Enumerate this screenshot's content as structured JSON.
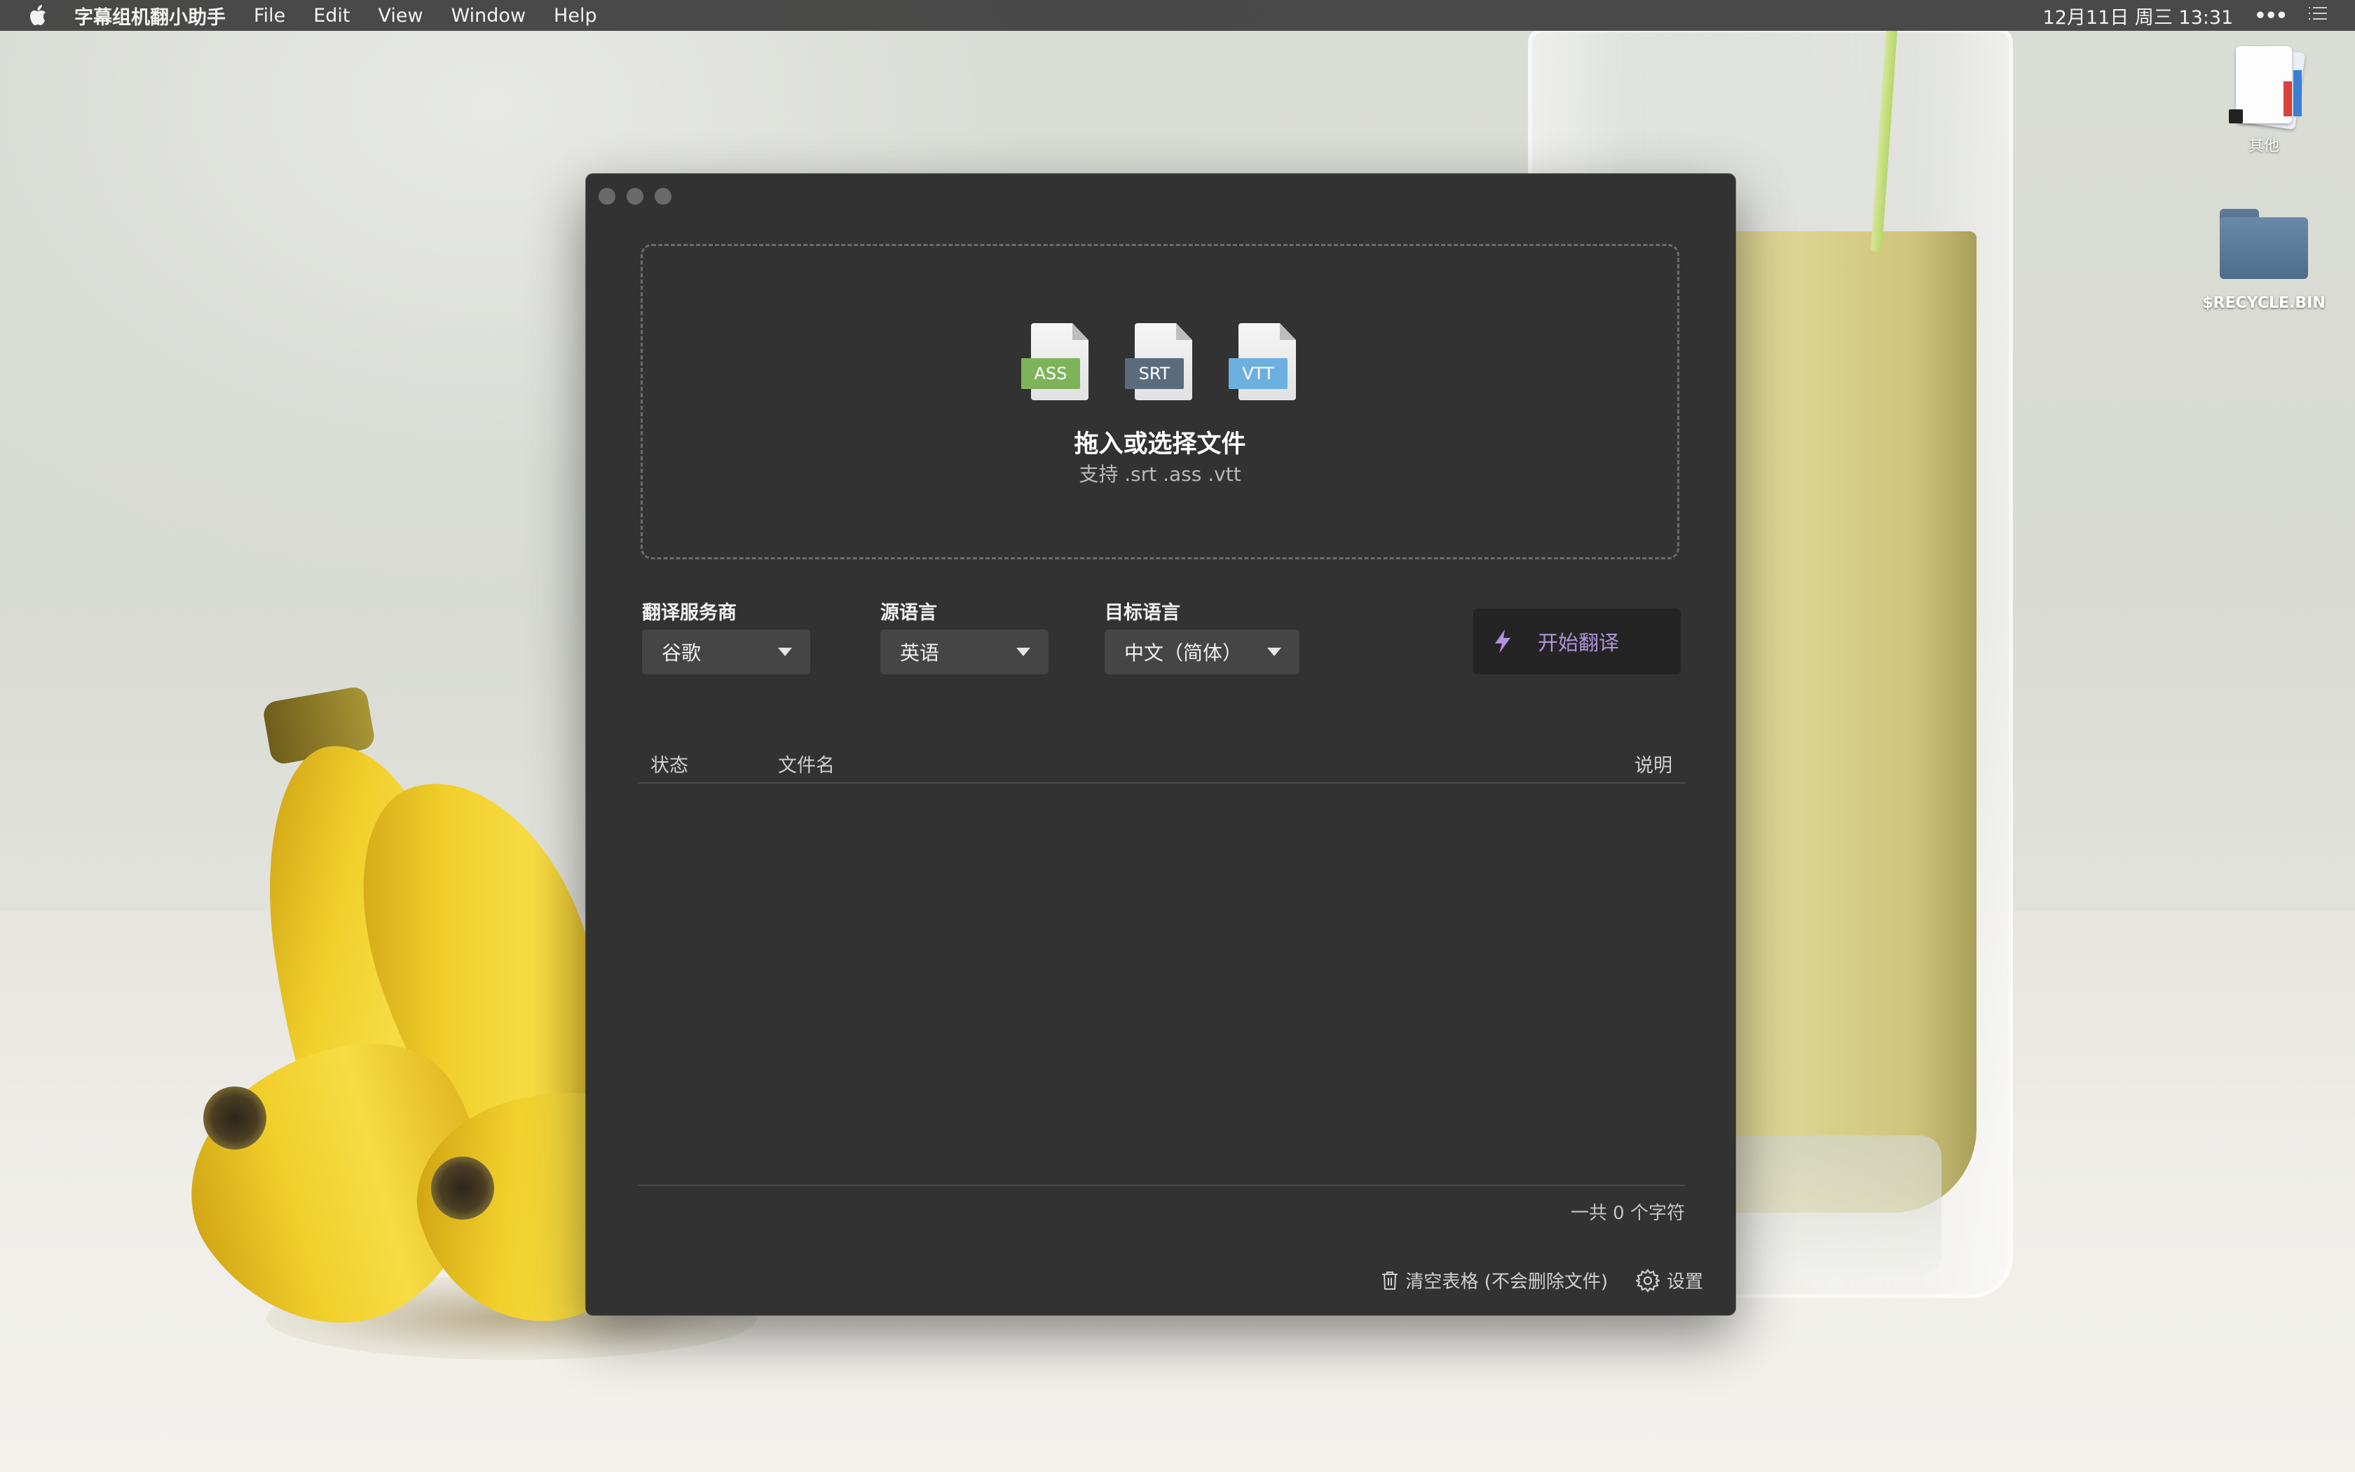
{
  "menubar": {
    "app_name": "字幕组机翻小助手",
    "items": [
      "File",
      "Edit",
      "View",
      "Window",
      "Help"
    ],
    "datetime": "12月11日 周三 13:31"
  },
  "desktop": {
    "icons": [
      {
        "label": "其他",
        "icon": "document-stack-icon"
      },
      {
        "label": "$RECYCLE.BIN",
        "icon": "folder-icon"
      }
    ]
  },
  "window": {
    "dropzone": {
      "file_types": [
        {
          "label": "ASS",
          "color": "#7db45a"
        },
        {
          "label": "SRT",
          "color": "#5b6b7e"
        },
        {
          "label": "VTT",
          "color": "#6cb0e0"
        }
      ],
      "title": "拖入或选择文件",
      "subtitle": "支持 .srt .ass .vtt"
    },
    "provider": {
      "label": "翻译服务商",
      "value": "谷歌"
    },
    "source_language": {
      "label": "源语言",
      "value": "英语"
    },
    "target_language": {
      "label": "目标语言",
      "value": "中文（简体）"
    },
    "start_button": {
      "label": "开始翻译",
      "icon": "lightning-icon",
      "color": "#b193d9"
    },
    "table": {
      "columns": [
        "状态",
        "文件名",
        "说明"
      ],
      "rows": []
    },
    "char_count": "一共 0 个字符",
    "clear_button": {
      "label": "清空表格 (不会删除文件)",
      "icon": "trash-icon"
    },
    "settings_button": {
      "label": "设置",
      "icon": "gear-icon"
    }
  }
}
